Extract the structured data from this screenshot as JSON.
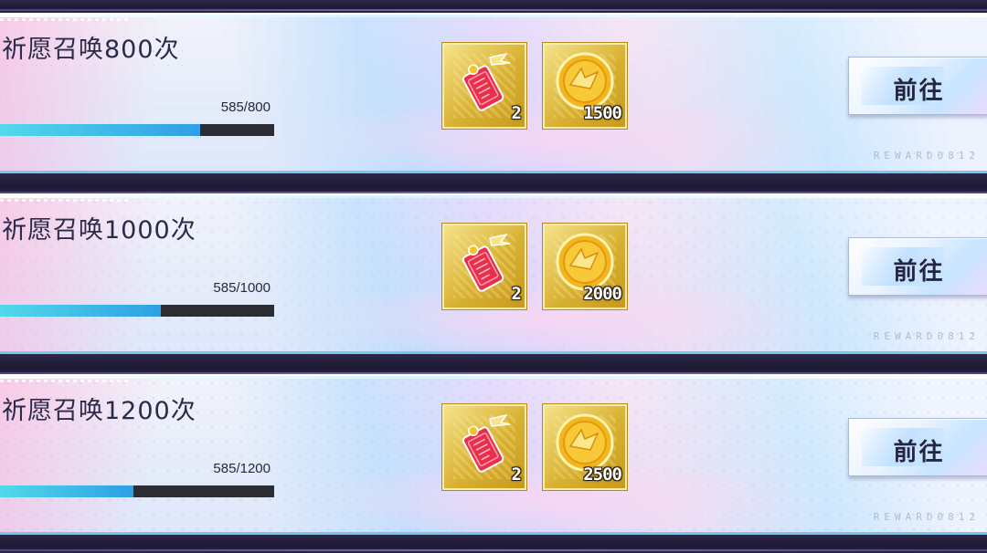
{
  "go_label": "前往",
  "reward_code": "REWARD0812",
  "colors": {
    "progress_fill": "#2f9fe6",
    "progress_track": "#2b2d33",
    "item_gold": "#d8b132"
  },
  "tasks": [
    {
      "title": "祈愿召唤800次",
      "progress_text": "585/800",
      "progress_fraction": 0.731,
      "rewards": [
        {
          "icon": "red-charm-icon",
          "count": "2"
        },
        {
          "icon": "gold-coin-icon",
          "count": "1500"
        }
      ]
    },
    {
      "title": "祈愿召唤1000次",
      "progress_text": "585/1000",
      "progress_fraction": 0.585,
      "rewards": [
        {
          "icon": "red-charm-icon",
          "count": "2"
        },
        {
          "icon": "gold-coin-icon",
          "count": "2000"
        }
      ]
    },
    {
      "title": "祈愿召唤1200次",
      "progress_text": "585/1200",
      "progress_fraction": 0.4875,
      "rewards": [
        {
          "icon": "red-charm-icon",
          "count": "2"
        },
        {
          "icon": "gold-coin-icon",
          "count": "2500"
        }
      ]
    }
  ]
}
